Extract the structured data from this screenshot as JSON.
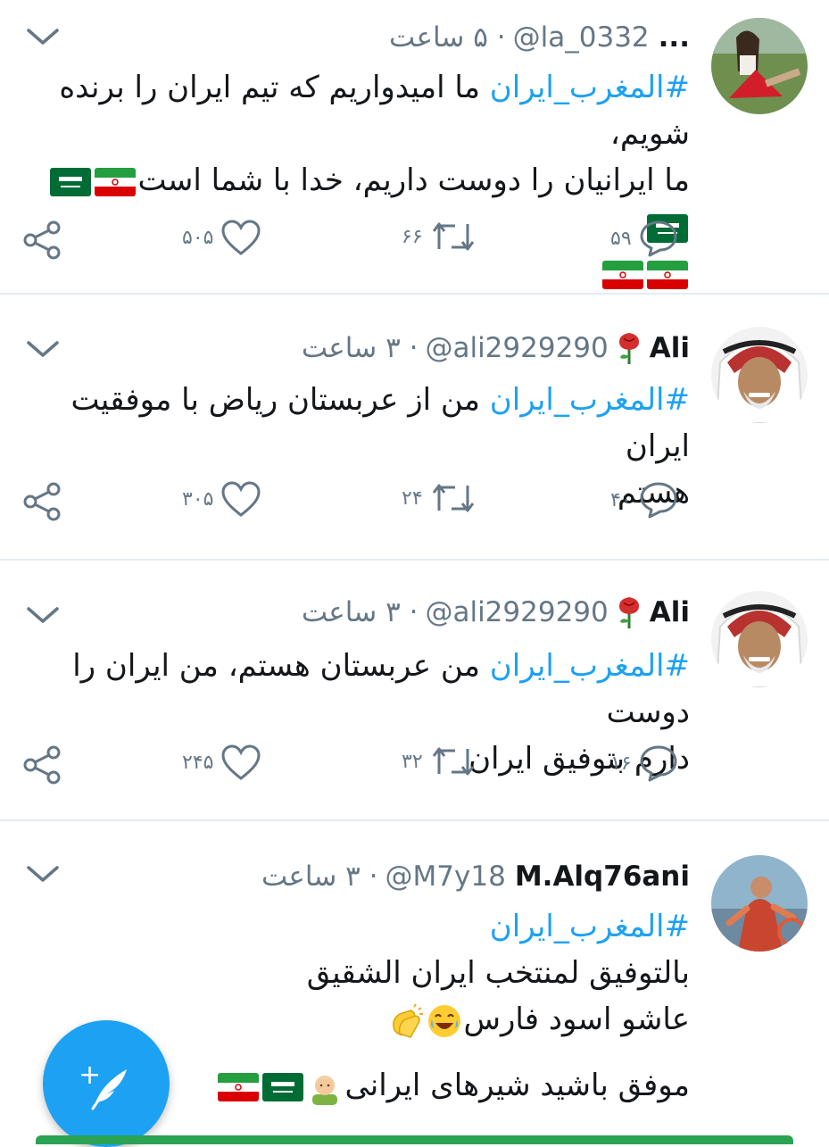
{
  "colors": {
    "accent": "#1da1f2",
    "muted": "#657786",
    "text": "#14171a",
    "divider": "#e6ecf0"
  },
  "tweets": [
    {
      "name": "...",
      "handle": "@la_0332",
      "meta": "· ۵ ساعت",
      "hashtag": "#المغرب_ایران",
      "lines": [
        "ما امیدواریم که تیم ایران را برنده شویم،",
        "ما ایرانیان را دوست داریم، خدا با شما است"
      ],
      "icons": [
        "flag-iran",
        "flag-saudi",
        "flag-saudi",
        "flag-iran",
        "flag-iran"
      ],
      "replies": "۵۹",
      "retweets": "۶۶",
      "likes": "۵۰۵"
    },
    {
      "name": "Ali",
      "handle": "@ali2929290",
      "meta": "· ۳ ساعت",
      "hashtag": "#المغرب_ایران",
      "lines": [
        "من از عربستان ریاض با موفقیت ایران",
        "هستم"
      ],
      "icons": [
        "rose-icon"
      ],
      "replies": "۴۰",
      "retweets": "۲۴",
      "likes": "۳۰۵"
    },
    {
      "name": "Ali",
      "handle": "@ali2929290",
      "meta": "· ۳ ساعت",
      "hashtag": "#المغرب_ایران",
      "lines": [
        "من عربستان هستم، من ایران را دوست",
        "دارم بتوفیق ایران"
      ],
      "icons": [
        "rose-icon"
      ],
      "replies": "۱۶",
      "retweets": "۳۲",
      "likes": "۲۴۵"
    },
    {
      "name": "M.Alq76ani",
      "handle": "@M7y18",
      "meta": "· ۳ ساعت",
      "hashtag": "#المغرب_ایران",
      "lines": [
        "بالتوفيق لمنتخب ايران الشقيق",
        "عاشو اسود فارس",
        "موفق باشید شیرهای ایرانی"
      ],
      "icons": [
        "laughing-emoji",
        "clapping-emoji",
        "old-man-emoji",
        "flag-saudi",
        "flag-iran"
      ]
    }
  ],
  "compose_button": {
    "label": "+"
  }
}
